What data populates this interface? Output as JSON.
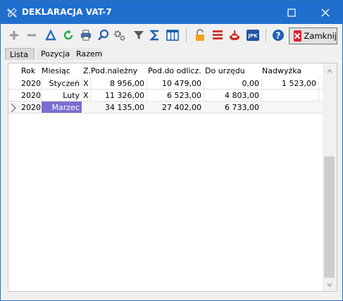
{
  "window": {
    "title": "DEKLARACJA VAT-7"
  },
  "toolbar": {
    "close_label": "Zamknij"
  },
  "tabs": [
    {
      "label": "Lista"
    },
    {
      "label": "Pozycja"
    },
    {
      "label": "Razem"
    }
  ],
  "grid": {
    "columns": [
      "Rok",
      "Miesiąc",
      "Z.",
      "Pod.należny",
      "Pod.do odlicz.",
      "Do urzędu",
      "Nadwyżka"
    ],
    "rows": [
      {
        "rok": "2020",
        "miesiac": "Styczeń",
        "z": "X",
        "pod_nalezny": "8 956,00",
        "pod_do_odlicz": "10 479,00",
        "do_urzedu": "0,00",
        "nadwyzka": "1 523,00"
      },
      {
        "rok": "2020",
        "miesiac": "Luty",
        "z": "X",
        "pod_nalezny": "11 326,00",
        "pod_do_odlicz": "6 523,00",
        "do_urzedu": "4 803,00",
        "nadwyzka": ""
      },
      {
        "rok": "2020",
        "miesiac": "Marzec",
        "z": "",
        "pod_nalezny": "34 135,00",
        "pod_do_odlicz": "27 402,00",
        "do_urzedu": "6 733,00",
        "nadwyzka": ""
      }
    ]
  },
  "colors": {
    "titlebar": "#1f6fcf",
    "selection": "#7b6fd0",
    "close_icon": "#d9262d"
  },
  "icons": [
    "plus-icon",
    "minus-icon",
    "delta-icon",
    "refresh-icon",
    "print-icon",
    "search-icon",
    "settings-icon",
    "filter-icon",
    "sigma-icon",
    "columns-icon",
    "lock-icon",
    "stack-icon",
    "export-icon",
    "jpk-icon",
    "help-icon",
    "close-icon"
  ]
}
